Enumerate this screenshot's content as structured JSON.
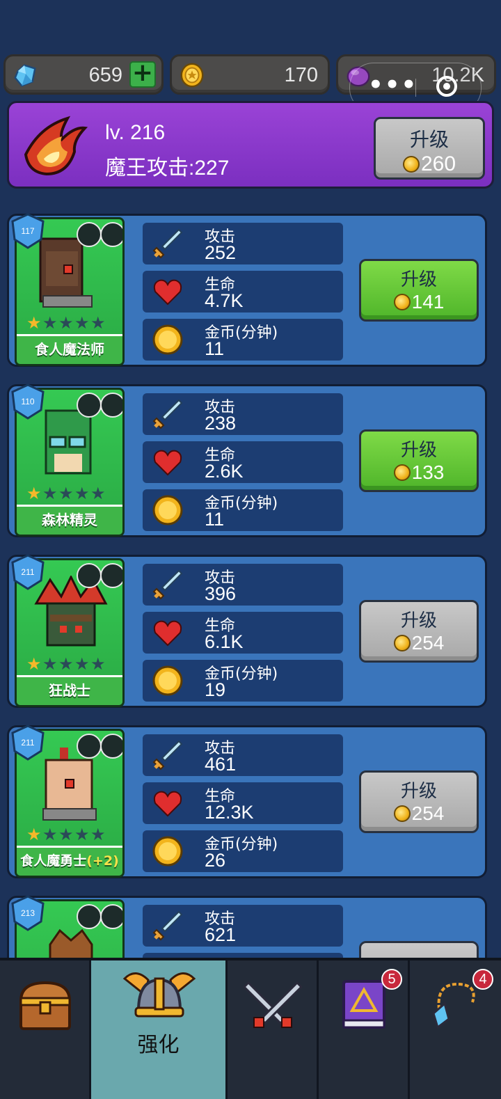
{
  "resources": {
    "gems": "659",
    "gold": "170",
    "orbs": "10.2K"
  },
  "boss": {
    "level": "lv. 216",
    "attack": "魔王攻击:227",
    "upgrade_label": "升级",
    "upgrade_cost": "260"
  },
  "heroes": [
    {
      "name": "食人魔法师",
      "name_plus": "",
      "level": "117",
      "stars": 1,
      "attack_label": "攻击",
      "attack": "252",
      "hp_label": "生命",
      "hp": "4.7K",
      "gold_label": "金币(分钟)",
      "gold": "11",
      "upgrade_label": "升级",
      "upgrade_cost": "141",
      "upgrade_available": true
    },
    {
      "name": "森林精灵",
      "name_plus": "",
      "level": "110",
      "stars": 1,
      "attack_label": "攻击",
      "attack": "238",
      "hp_label": "生命",
      "hp": "2.6K",
      "gold_label": "金币(分钟)",
      "gold": "11",
      "upgrade_label": "升级",
      "upgrade_cost": "133",
      "upgrade_available": true
    },
    {
      "name": "狂战士",
      "name_plus": "",
      "level": "211",
      "stars": 1,
      "attack_label": "攻击",
      "attack": "396",
      "hp_label": "生命",
      "hp": "6.1K",
      "gold_label": "金币(分钟)",
      "gold": "19",
      "upgrade_label": "升级",
      "upgrade_cost": "254",
      "upgrade_available": false
    },
    {
      "name": "食人魔勇士",
      "name_plus": "(+2)",
      "level": "211",
      "stars": 1,
      "attack_label": "攻击",
      "attack": "461",
      "hp_label": "生命",
      "hp": "12.3K",
      "gold_label": "金币(分钟)",
      "gold": "26",
      "upgrade_label": "升级",
      "upgrade_cost": "254",
      "upgrade_available": false
    },
    {
      "name": "",
      "name_plus": "",
      "level": "213",
      "stars": 1,
      "attack_label": "攻击",
      "attack": "621",
      "hp_label": "",
      "hp": "",
      "gold_label": "",
      "gold": "",
      "upgrade_label": "",
      "upgrade_cost": "",
      "upgrade_available": false
    }
  ],
  "tabs": [
    {
      "icon": "treasure-chest-icon",
      "label": ""
    },
    {
      "icon": "winged-helmet-icon",
      "label": "强化",
      "active": true
    },
    {
      "icon": "crossed-swords-icon",
      "label": ""
    },
    {
      "icon": "spellbook-icon",
      "label": "",
      "badge": "5"
    },
    {
      "icon": "amulet-icon",
      "label": "",
      "badge": "4"
    }
  ],
  "colors": {
    "background": "#1c3259",
    "boss_panel": "#8a3ccb",
    "hero_panel": "#3a75bb",
    "upgrade_green": "#5cc234",
    "upgrade_gray": "#b5b5b5",
    "active_tab": "#6aa8ad"
  }
}
